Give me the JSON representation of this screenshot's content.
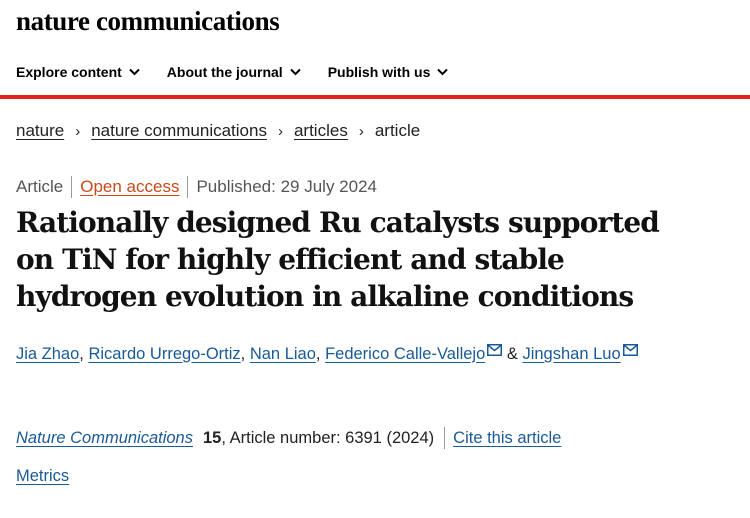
{
  "site": {
    "logo": "nature communications"
  },
  "nav": {
    "items": [
      {
        "label": "Explore content"
      },
      {
        "label": "About the journal"
      },
      {
        "label": "Publish with us"
      }
    ]
  },
  "breadcrumb": {
    "items": [
      "nature",
      "nature communications",
      "articles"
    ],
    "current": "article"
  },
  "meta": {
    "type": "Article",
    "access": "Open access",
    "published": "Published: 29 July 2024"
  },
  "article": {
    "title_lines": [
      "Rationally designed Ru catalysts supported",
      "on TiN for highly efficient and stable",
      "hydrogen evolution in alkaline conditions"
    ],
    "authors": [
      "Jia Zhao",
      "Ricardo Urrego-Ortiz",
      "Nan Liao",
      "Federico Calle-Vallejo",
      "Jingshan Luo"
    ],
    "author_separator": ", ",
    "author_and": " & "
  },
  "citation": {
    "journal": "Nature Communications",
    "volume": "15",
    "rest": ", Article number: 6391 (2024)",
    "cite_label": "Cite this article"
  },
  "metrics": {
    "label": "Metrics"
  },
  "colors": {
    "accent_red": "#e0261b",
    "link_blue": "#1a5a96",
    "open_access_orange": "#c94a1a"
  },
  "icons": {
    "nav_dropdown": "chevron-down-icon",
    "corresponding_author": "mail-icon"
  }
}
